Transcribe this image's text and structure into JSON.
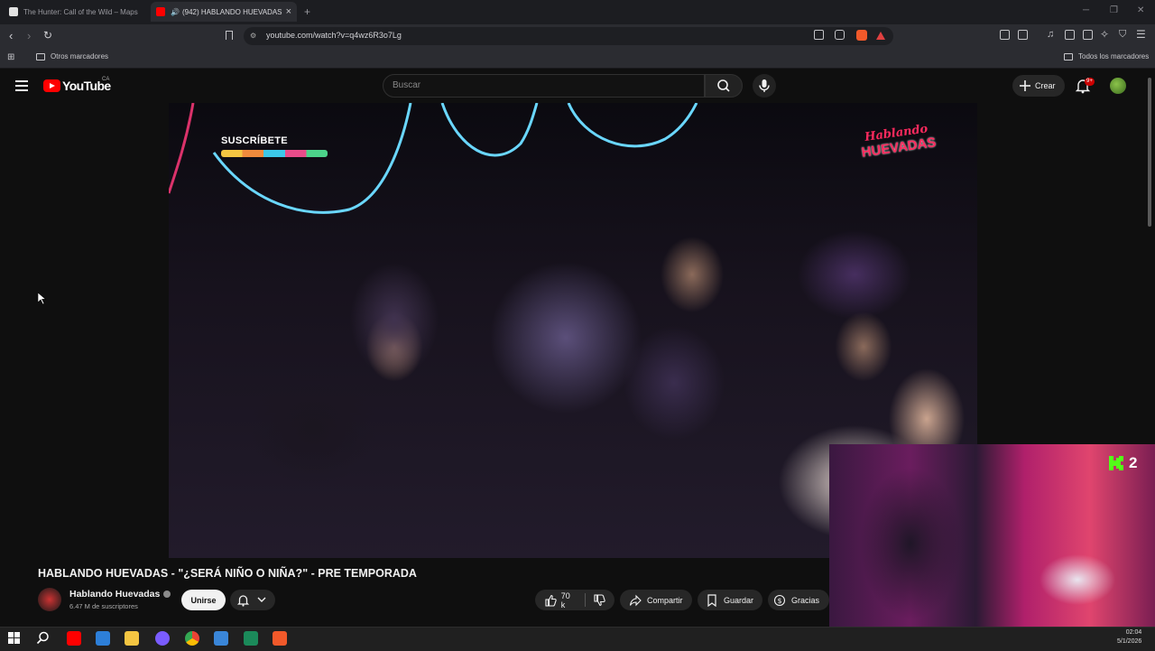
{
  "browser": {
    "tabs": [
      {
        "title": "The Hunter: Call of the Wild – Maps",
        "favicon_color": "#e2e2e2"
      },
      {
        "title": "(942) HABLANDO HUEVADAS",
        "favicon_color": "#ff0000",
        "audio": "🔊"
      }
    ],
    "new_tab": "+",
    "url": "youtube.com/watch?v=q4wz6R3o7Lg",
    "bookmarks": {
      "left": "Otros marcadores",
      "right": "Todos los marcadores"
    }
  },
  "youtube": {
    "logo": "YouTube",
    "country": "CA",
    "search_placeholder": "Buscar",
    "create_label": "Crear",
    "notif_badge": "9+"
  },
  "video": {
    "overlay_subscribe": "SUSCRÍBETE",
    "overlay_logo_line1": "Hablando",
    "overlay_logo_line2": "HUEVADAS",
    "title": "HABLANDO HUEVADAS - \"¿SERÁ NIÑO O NIÑA?\" - PRE TEMPORADA",
    "channel_name": "Hablando Huevadas",
    "subscribers": "6.47 M de suscriptores",
    "join_label": "Unirse",
    "likes": "70 k",
    "share_label": "Compartir",
    "save_label": "Guardar",
    "thanks_label": "Gracias"
  },
  "stream_overlay": {
    "badge_number": "2",
    "badge_color": "#53fc18"
  },
  "taskbar": {
    "time": "02:04",
    "date": "5/1/2026"
  },
  "colors": {
    "yt_red": "#ff0000",
    "bg": "#0f0f0f",
    "kick_green": "#53fc18"
  }
}
